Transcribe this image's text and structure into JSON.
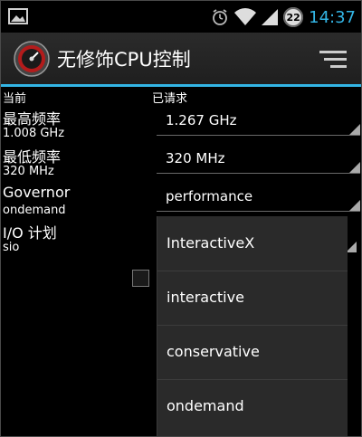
{
  "status": {
    "badge": "22",
    "time": "14:37"
  },
  "app": {
    "title": "无修饰CPU控制"
  },
  "current": {
    "header": "当前",
    "max_label": "最高频率",
    "max_value": "1.008 GHz",
    "min_label": "最低频率",
    "min_value": "320 MHz",
    "governor_label": "Governor",
    "governor_value": "ondemand",
    "io_label": "I/O 计划",
    "io_value": "sio"
  },
  "requested": {
    "header": "已请求",
    "max_freq": "1.267 GHz",
    "min_freq": "320 MHz",
    "governor": "performance"
  },
  "dropdown": {
    "options": [
      "InteractiveX",
      "interactive",
      "conservative",
      "ondemand"
    ]
  },
  "colors": {
    "accent": "#33b5e5",
    "background": "#000000",
    "dropdown_bg": "#2a2a2a"
  }
}
